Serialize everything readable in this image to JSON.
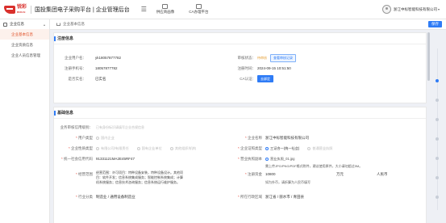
{
  "header": {
    "logo_text": "锐彩",
    "logo_sub": "RUICAI",
    "system_title": "国投集团电子采购平台 | 企业管理后台",
    "nav": [
      {
        "label": "供应商画像"
      },
      {
        "label": "CA办理平台"
      }
    ],
    "user_name": "浙江中标智能科技有限公司"
  },
  "sidebar": {
    "group_label": "企业信息",
    "items": [
      {
        "label": "企业基本信息",
        "active": true
      },
      {
        "label": "企业资质信息",
        "active": false
      },
      {
        "label": "企业人员信息管理",
        "active": false
      }
    ]
  },
  "breadcrumb": {
    "text": "企业基本信息"
  },
  "toolbar": {
    "save_label": "保存"
  },
  "register": {
    "title": "注册信息",
    "account_label": "企业用户名：",
    "account_value": "yk18057877782",
    "review_label": "审核状态：",
    "review_value": "待审核",
    "review_btn": "查看审核记录",
    "phone_label": "注册手机号：",
    "phone_value": "18057877782",
    "time_label": "注册时间：",
    "time_value": "2024-09-15 10:51:50",
    "identity_label": "是否实名：",
    "identity_value": "已实名",
    "ca_label": "CA认证：",
    "ca_btn": "去绑定"
  },
  "basic": {
    "title": "基础信息",
    "role_label": "业务审核信用级别：",
    "role_placeholder": "已有身份标识请填写企业合规信息",
    "enterprise_type_label": "用户类型",
    "enterprise_type_value": "国内企业",
    "name_label": "企业名称",
    "name_value": "浙江中标智能科技有限公司",
    "owner_label": "企业性质类型",
    "owner_options": [
      "有限公司/有限责任",
      "国有企业单位",
      "其他组织/机构"
    ],
    "license_type_label": "企业证照类型",
    "license_type_options": [
      "三证合一(统一社会)",
      "普通营业执照"
    ],
    "credit_label": "统一社会信用代码",
    "credit_value": "91331121MA2E45RF47",
    "license_file_label": "营业执照副本",
    "license_file_value": "营业执照_01.jpg",
    "license_note": "需上传JPG/PNG/PDF格式附件，建议使用原件，大小请勿超过5M。",
    "scope_label": "经营范围",
    "scope_value": "经营范围：许可项目：特种设备安装，特种设备设计。其他项目：软件开发；信息系统集成服务；智能控制系统集成；计算机系统服务；信息技术咨询服务；信息系统运行维护服务。",
    "capital_label": "注册资金",
    "capital_value": "10800",
    "capital_unit": "万元",
    "capital_currency": "人民币",
    "capital_note": "如为外币，请折算为人民币填写",
    "industry_label": "行业分类",
    "industry_value": "制造业 / 通用设备制造业",
    "region_label": "所在行政区域",
    "region_value": "浙江省 / 丽水市 / 青田县"
  }
}
